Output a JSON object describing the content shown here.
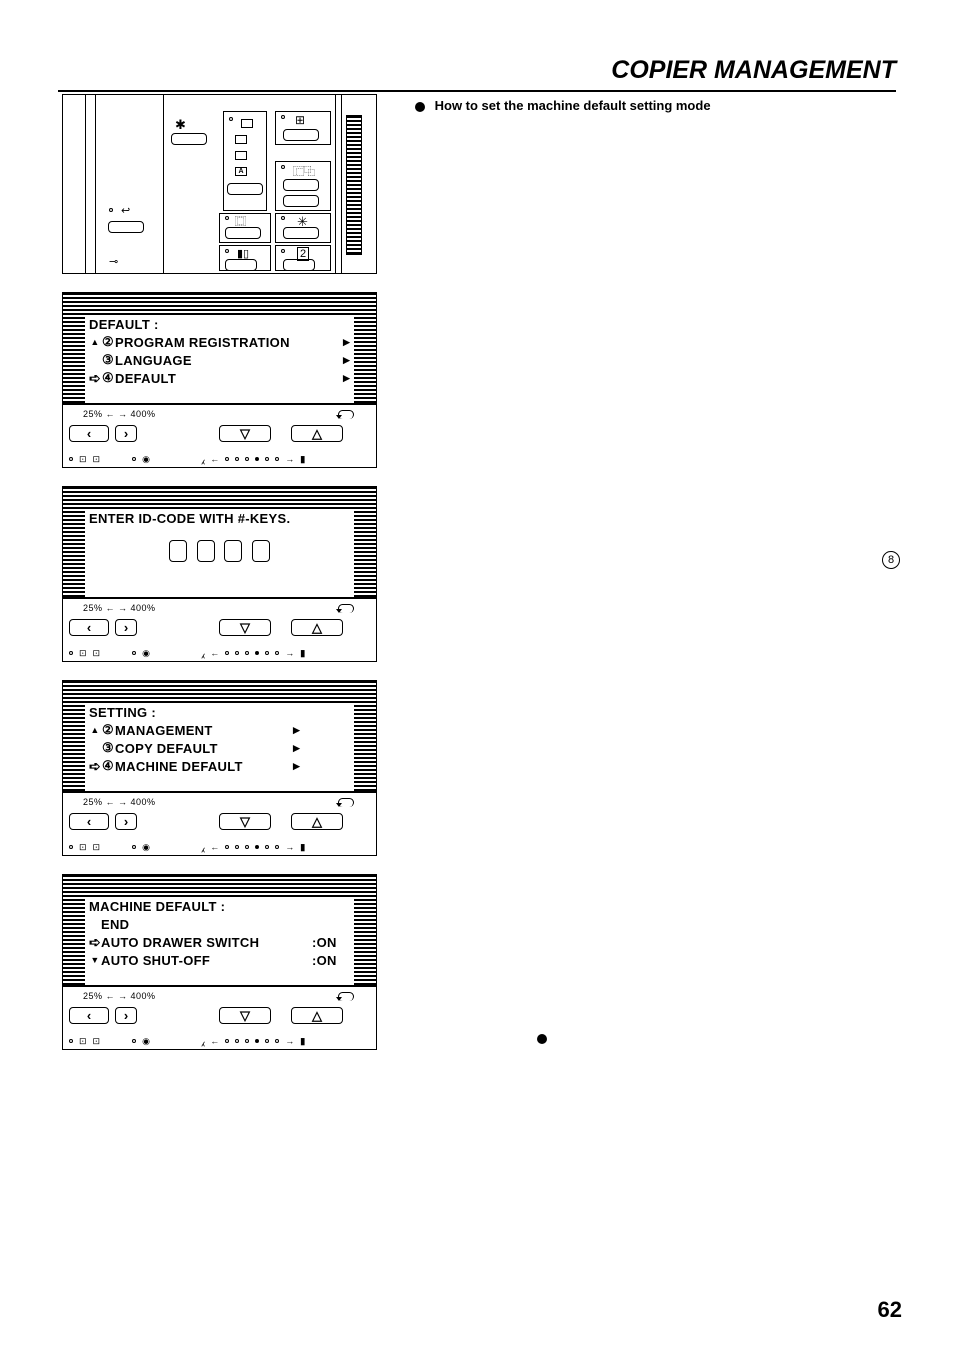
{
  "page_title": "COPIER MANAGEMENT",
  "section_heading": "How to set the machine default setting mode",
  "step_marker": "8",
  "page_number": "62",
  "nav_zoom_label": "25% ←    → 400%",
  "lcd1": {
    "title": "DEFAULT :",
    "items": [
      {
        "num": "②",
        "label": "PROGRAM REGISTRATION",
        "arrow": "▸"
      },
      {
        "num": "③",
        "label": "LANGUAGE",
        "arrow": "▸"
      },
      {
        "num": "④",
        "label": "DEFAULT",
        "arrow": "▸",
        "selected": true
      }
    ]
  },
  "lcd2": {
    "title": "ENTER ID-CODE WITH #-KEYS."
  },
  "lcd3": {
    "title": "SETTING :",
    "items": [
      {
        "num": "②",
        "label": "MANAGEMENT",
        "arrow": "▸"
      },
      {
        "num": "③",
        "label": "COPY DEFAULT",
        "arrow": "▸"
      },
      {
        "num": "④",
        "label": "MACHINE DEFAULT",
        "arrow": "▸",
        "selected": true
      }
    ]
  },
  "lcd4": {
    "title": "MACHINE DEFAULT :",
    "items": [
      {
        "label": "END",
        "value": ""
      },
      {
        "label": "AUTO DRAWER SWITCH",
        "value": ":ON",
        "selected": true
      },
      {
        "label": "AUTO SHUT-OFF",
        "value": ":ON"
      }
    ]
  }
}
